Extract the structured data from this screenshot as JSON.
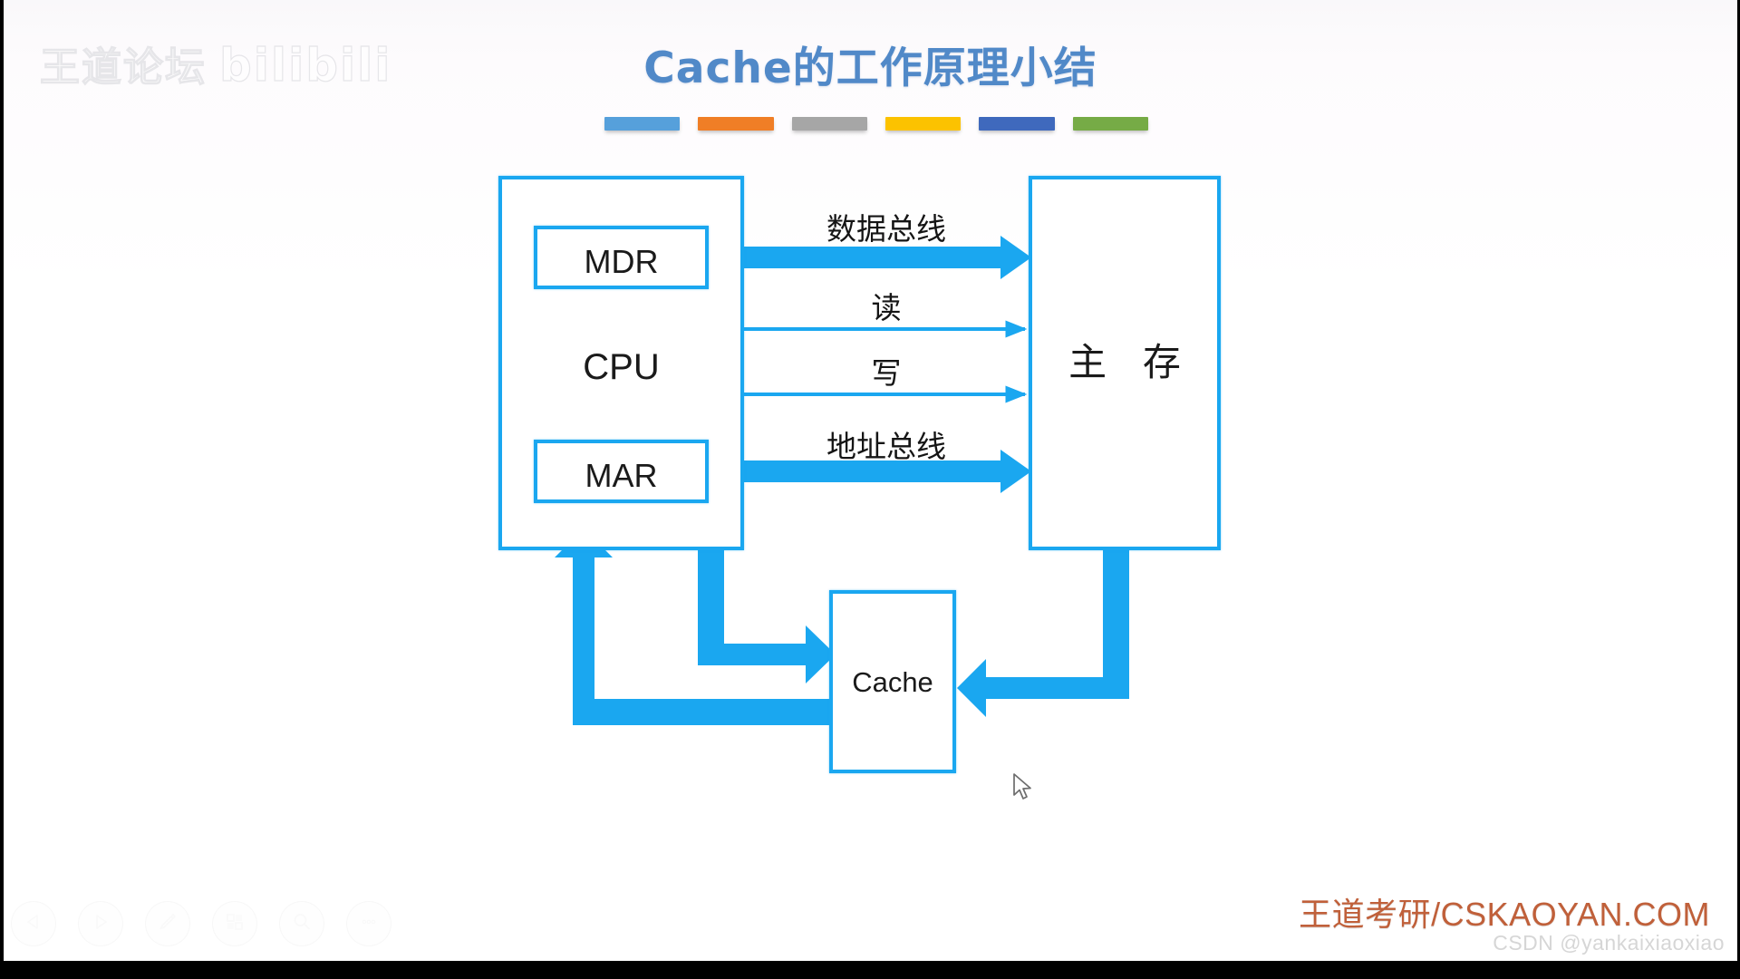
{
  "slide": {
    "title_en": "Cache",
    "title_zh": "的工作原理小结",
    "accent_bars": [
      {
        "name": "bar-blue-light",
        "color": "#56a0db"
      },
      {
        "name": "bar-orange",
        "color": "#f07e26"
      },
      {
        "name": "bar-gray",
        "color": "#a6a6a6"
      },
      {
        "name": "bar-yellow",
        "color": "#fcc200"
      },
      {
        "name": "bar-blue-dark",
        "color": "#3f69bd"
      },
      {
        "name": "bar-green",
        "color": "#76ab46"
      }
    ],
    "background_color": "#ffffff",
    "diagram_accent_color": "#1aa7f0",
    "title_color": "#5189c8"
  },
  "diagram": {
    "cpu": {
      "label": "CPU"
    },
    "mdr": {
      "label": "MDR"
    },
    "mar": {
      "label": "MAR"
    },
    "main_memory": {
      "label": "主 存"
    },
    "cache": {
      "label": "Cache"
    },
    "buses": [
      {
        "id": "data-bus",
        "label": "数据总线",
        "direction": "bidirectional",
        "from": "MDR",
        "to": "主 存",
        "weight": "thick"
      },
      {
        "id": "read-line",
        "label": "读",
        "direction": "right",
        "from": "CPU",
        "to": "主 存",
        "weight": "thin"
      },
      {
        "id": "write-line",
        "label": "写",
        "direction": "right",
        "from": "CPU",
        "to": "主 存",
        "weight": "thin"
      },
      {
        "id": "address-bus",
        "label": "地址总线",
        "direction": "right",
        "from": "MAR",
        "to": "主 存",
        "weight": "thick"
      }
    ],
    "cache_links": [
      {
        "id": "cpu-to-cache",
        "from": "CPU",
        "to": "Cache",
        "direction": "right"
      },
      {
        "id": "cache-to-cpu",
        "from": "Cache",
        "to": "CPU",
        "direction": "up"
      },
      {
        "id": "memory-to-cache",
        "from": "主 存",
        "to": "Cache",
        "direction": "left"
      }
    ]
  },
  "toolbar": {
    "items": [
      {
        "name": "previous-slide-button",
        "icon": "triangle-left-icon",
        "label": "上一页"
      },
      {
        "name": "next-slide-button",
        "icon": "triangle-right-icon",
        "label": "下一页"
      },
      {
        "name": "annotate-button",
        "icon": "pen-icon",
        "label": "画笔"
      },
      {
        "name": "layout-button",
        "icon": "grid-icon",
        "label": "布局"
      },
      {
        "name": "search-button",
        "icon": "search-icon",
        "label": "搜索"
      },
      {
        "name": "more-button",
        "icon": "ellipsis-icon",
        "label": "更多"
      }
    ]
  },
  "watermarks": {
    "top_left_text": "王道论坛",
    "top_left_logo": "bilibili",
    "brand": "王道考研/CSKAOYAN.COM",
    "brand_color": "#c0603a",
    "csdn": "CSDN @yankaixiaoxiao"
  }
}
